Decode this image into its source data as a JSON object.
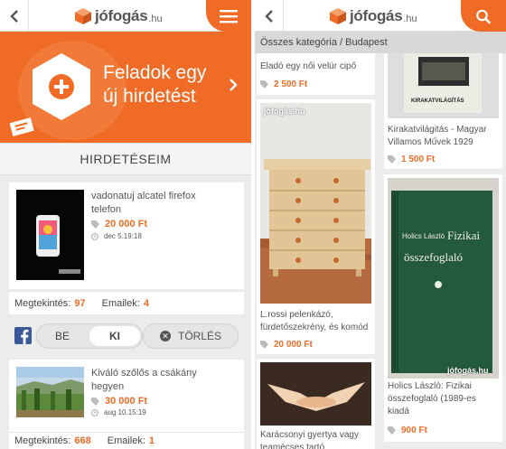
{
  "brand": {
    "name": "jófogás",
    "tld": ".hu",
    "accent_color": "#ef6b26"
  },
  "left_screen": {
    "header": {
      "back_icon": "chevron-left-icon",
      "menu_icon": "hamburger-menu-icon"
    },
    "banner": {
      "line1": "Feladok egy",
      "line2": "új hirdetést",
      "icon": "plus-hexagon-icon"
    },
    "section_title": "HIRDETÉSEIM",
    "ads": [
      {
        "title_line1": "vadonatuj alcatel firefox",
        "title_line2": "telefon",
        "price": "20 000 Ft",
        "date": "dec 5.19:18",
        "views_label": "Megtekintés:",
        "views": "97",
        "emails_label": "Emailek:",
        "emails": "4"
      },
      {
        "title_line1": "Kiváló szőlős a csákány",
        "title_line2": "hegyen",
        "price": "30 000 Ft",
        "date": "aug 10.15:19",
        "views_label": "Megtekintés:",
        "views": "668",
        "emails_label": "Emailek:",
        "emails": "1"
      }
    ],
    "controls": {
      "toggle_on_label": "BE",
      "toggle_off_label": "KI",
      "selected": "KI",
      "delete_label": "TÖRLÉS"
    }
  },
  "right_screen": {
    "header": {
      "back_icon": "chevron-left-icon",
      "search_icon": "search-icon"
    },
    "breadcrumb": "Összes kategória / Budapest",
    "listings_col1": [
      {
        "title": "Eladó egy női velúr cipő",
        "price": "2 500 Ft"
      },
      {
        "title_line1": "L.rossi pelenkázó,",
        "title_line2": "fürdetőszekrény, és komód",
        "price": "20 000 Ft"
      },
      {
        "title_line1": "Karácsonyi gyertya vagy",
        "title_line2": "teamécses tartó"
      }
    ],
    "listings_col2": [
      {
        "title_line1": "Kirakatvilágitás - Magyar",
        "title_line2": "Villamos Művek 1929",
        "price": "1 500 Ft"
      },
      {
        "title_line1": "Holics László: Fizikai",
        "title_line2": "összefoglaló (1989-es",
        "title_line3": "kiadá",
        "price": "900 Ft"
      }
    ],
    "watermark": "jófogás.hu",
    "book_cover": {
      "author": "Holics László",
      "title_line1": "Fizikai",
      "title_line2": "összefoglaló"
    },
    "box_label": "KIRAKATVILÁGÍTÁS"
  }
}
